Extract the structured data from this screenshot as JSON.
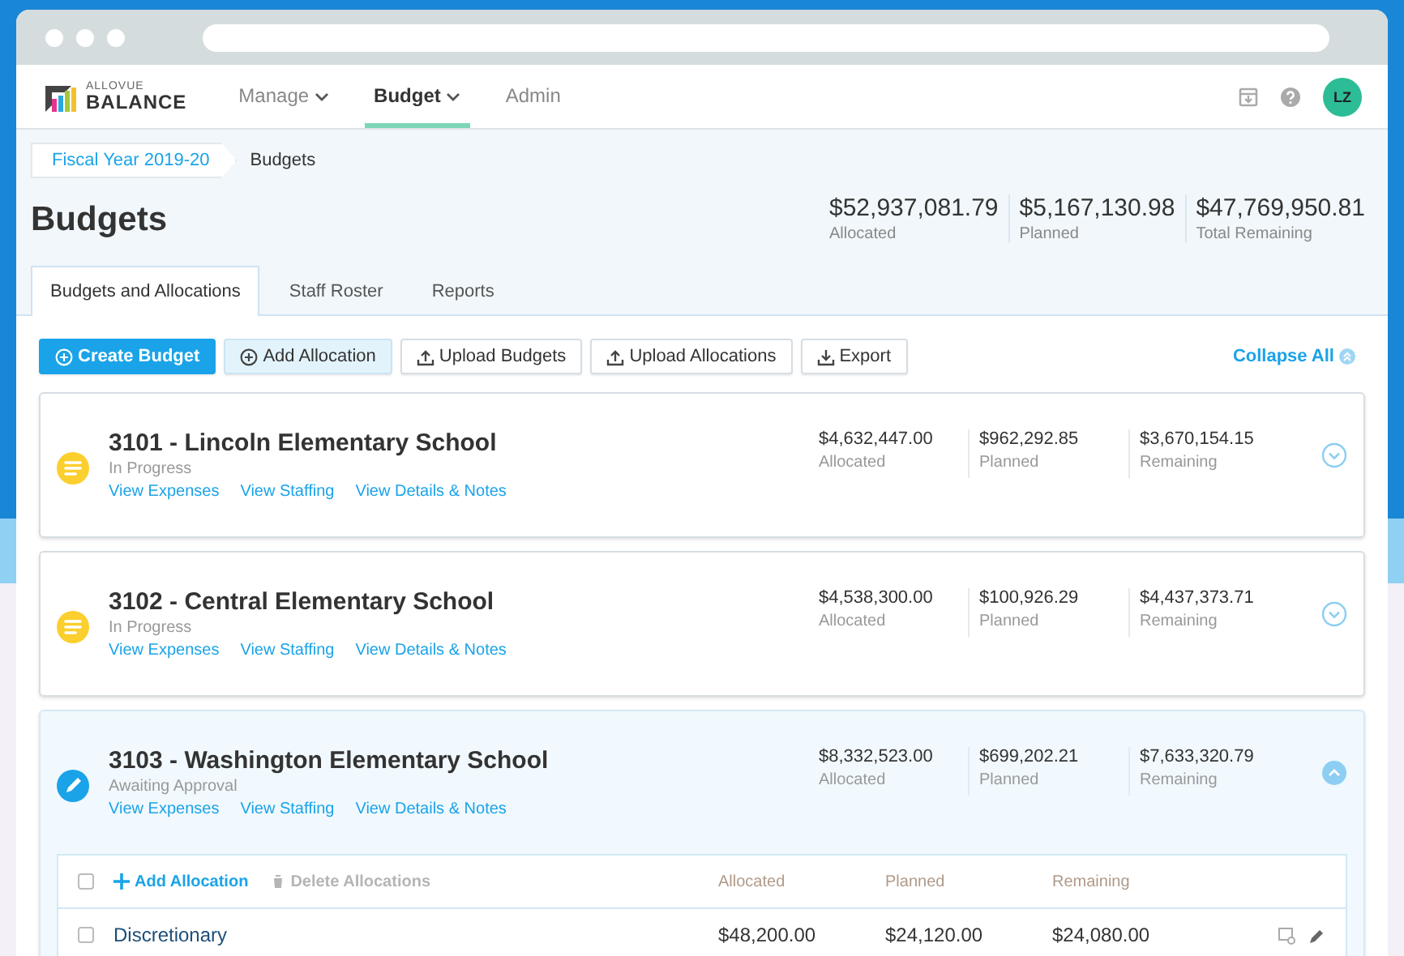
{
  "app": {
    "logo_top": "ALLOVUE",
    "logo_bottom": "BALANCE",
    "nav": [
      {
        "label": "Manage",
        "dropdown": true,
        "selected": false
      },
      {
        "label": "Budget",
        "dropdown": true,
        "selected": true
      },
      {
        "label": "Admin",
        "dropdown": false,
        "selected": false
      }
    ],
    "avatar": "LZ"
  },
  "breadcrumb": [
    "Fiscal Year 2019-20",
    "Budgets"
  ],
  "title": "Budgets",
  "totals": [
    {
      "value": "$52,937,081.79",
      "label": "Allocated"
    },
    {
      "value": "$5,167,130.98",
      "label": "Planned"
    },
    {
      "value": "$47,769,950.81",
      "label": "Total Remaining"
    }
  ],
  "tabs": [
    {
      "label": "Budgets and Allocations",
      "selected": true
    },
    {
      "label": "Staff Roster",
      "selected": false
    },
    {
      "label": "Reports",
      "selected": false
    }
  ],
  "toolbar": [
    {
      "label": "Create Budget",
      "kind": "primary"
    },
    {
      "label": "Add Allocation",
      "kind": "add"
    },
    {
      "label": "Upload Budgets",
      "kind": "upload"
    },
    {
      "label": "Upload Allocations",
      "kind": "upload"
    },
    {
      "label": "Export",
      "kind": "export"
    }
  ],
  "collapse_all": "Collapse All",
  "budgets": [
    {
      "name": "3101 - Lincoln Elementary School",
      "status": "In Progress",
      "kind": "in_progress",
      "expanded": false,
      "links": [
        "View Expenses",
        "View Staffing",
        "View Details & Notes"
      ],
      "figures": [
        {
          "value": "$4,632,447.00",
          "label": "Allocated"
        },
        {
          "value": "$962,292.85",
          "label": "Planned"
        },
        {
          "value": "$3,670,154.15",
          "label": "Remaining"
        }
      ]
    },
    {
      "name": "3102 - Central Elementary School",
      "status": "In Progress",
      "kind": "in_progress",
      "expanded": false,
      "links": [
        "View Expenses",
        "View Staffing",
        "View Details & Notes"
      ],
      "figures": [
        {
          "value": "$4,538,300.00",
          "label": "Allocated"
        },
        {
          "value": "$100,926.29",
          "label": "Planned"
        },
        {
          "value": "$4,437,373.71",
          "label": "Remaining"
        }
      ]
    },
    {
      "name": "3103 - Washington Elementary School",
      "status": "Awaiting Approval",
      "kind": "awaiting_approval",
      "expanded": true,
      "links": [
        "View Expenses",
        "View Staffing",
        "View Details & Notes"
      ],
      "figures": [
        {
          "value": "$8,332,523.00",
          "label": "Allocated"
        },
        {
          "value": "$699,202.21",
          "label": "Planned"
        },
        {
          "value": "$7,633,320.79",
          "label": "Remaining"
        }
      ],
      "allocations": {
        "all_checked": false,
        "add": "Add Allocation",
        "delete": {
          "label": "Delete Allocations",
          "disabled": true
        },
        "columns": [
          "Allocated",
          "Planned",
          "Remaining"
        ],
        "rows": [
          {
            "name": "Discretionary",
            "checked": false,
            "values": [
              "$48,200.00",
              "$24,120.00",
              "$24,080.00"
            ]
          }
        ]
      }
    }
  ]
}
